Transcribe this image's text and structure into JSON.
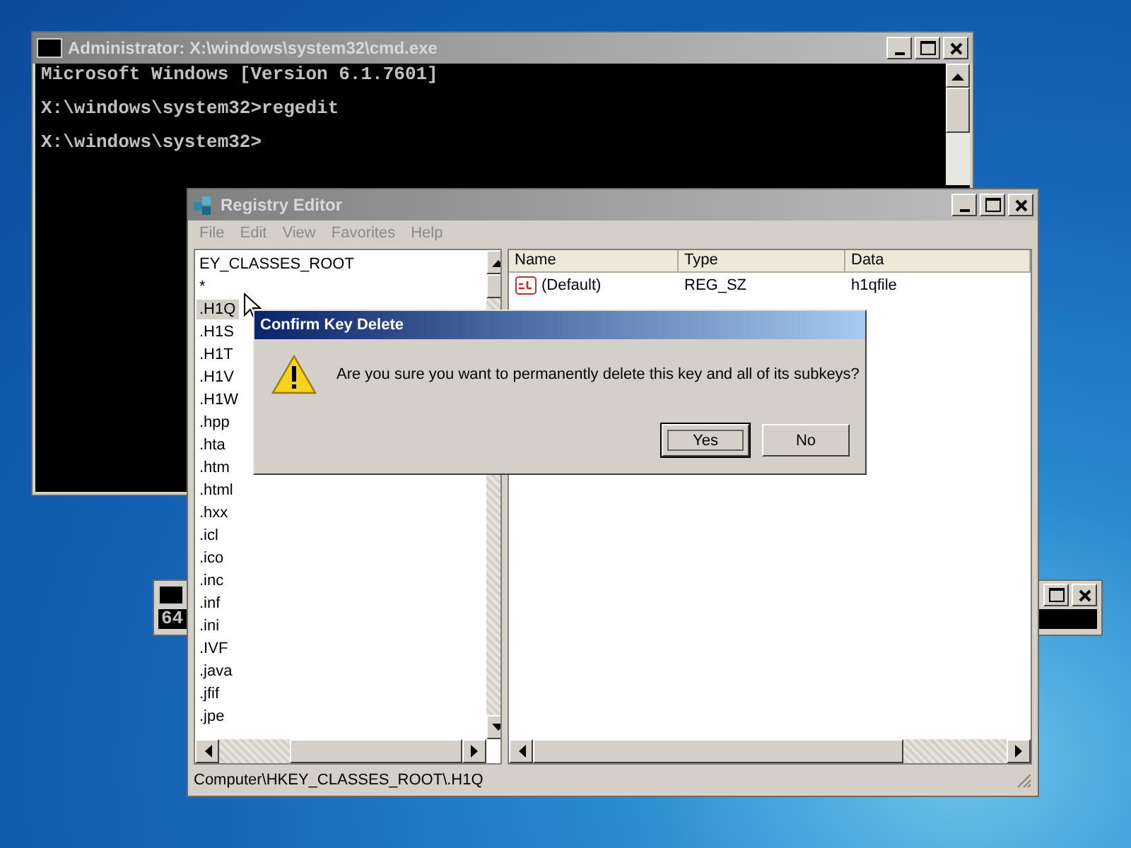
{
  "console": {
    "title": "Administrator: X:\\windows\\system32\\cmd.exe",
    "lines": [
      {
        "text": "Microsoft Windows [Version 6.1.7601]"
      },
      {
        "text": "X:\\windows\\system32>regedit"
      },
      {
        "text": "X:\\windows\\system32>"
      }
    ]
  },
  "console_behind": {
    "text": "64"
  },
  "registry": {
    "title": "Registry Editor",
    "menu": [
      "File",
      "Edit",
      "View",
      "Favorites",
      "Help"
    ],
    "tree": [
      {
        "label": "EY_CLASSES_ROOT",
        "selected": false
      },
      {
        "label": "*",
        "selected": false
      },
      {
        "label": ".H1Q",
        "selected": true
      },
      {
        "label": ".H1S",
        "selected": false
      },
      {
        "label": ".H1T",
        "selected": false
      },
      {
        "label": ".H1V",
        "selected": false
      },
      {
        "label": ".H1W",
        "selected": false
      },
      {
        "label": ".hpp",
        "selected": false
      },
      {
        "label": ".hta",
        "selected": false
      },
      {
        "label": ".htm",
        "selected": false
      },
      {
        "label": ".html",
        "selected": false
      },
      {
        "label": ".hxx",
        "selected": false
      },
      {
        "label": ".icl",
        "selected": false
      },
      {
        "label": ".ico",
        "selected": false
      },
      {
        "label": ".inc",
        "selected": false
      },
      {
        "label": ".inf",
        "selected": false
      },
      {
        "label": ".ini",
        "selected": false
      },
      {
        "label": ".IVF",
        "selected": false
      },
      {
        "label": ".java",
        "selected": false
      },
      {
        "label": ".jfif",
        "selected": false
      },
      {
        "label": ".jpe",
        "selected": false
      }
    ],
    "columns": [
      "Name",
      "Type",
      "Data"
    ],
    "rows": [
      {
        "name": "(Default)",
        "type": "REG_SZ",
        "data": "h1qfile"
      }
    ],
    "status_bar": "Computer\\HKEY_CLASSES_ROOT\\.H1Q"
  },
  "dialog": {
    "title": "Confirm Key Delete",
    "message": "Are you sure you want to permanently delete this key and all of its subkeys?",
    "buttons": [
      {
        "label": "Yes",
        "selected": true
      },
      {
        "label": "No",
        "selected": false
      }
    ]
  }
}
